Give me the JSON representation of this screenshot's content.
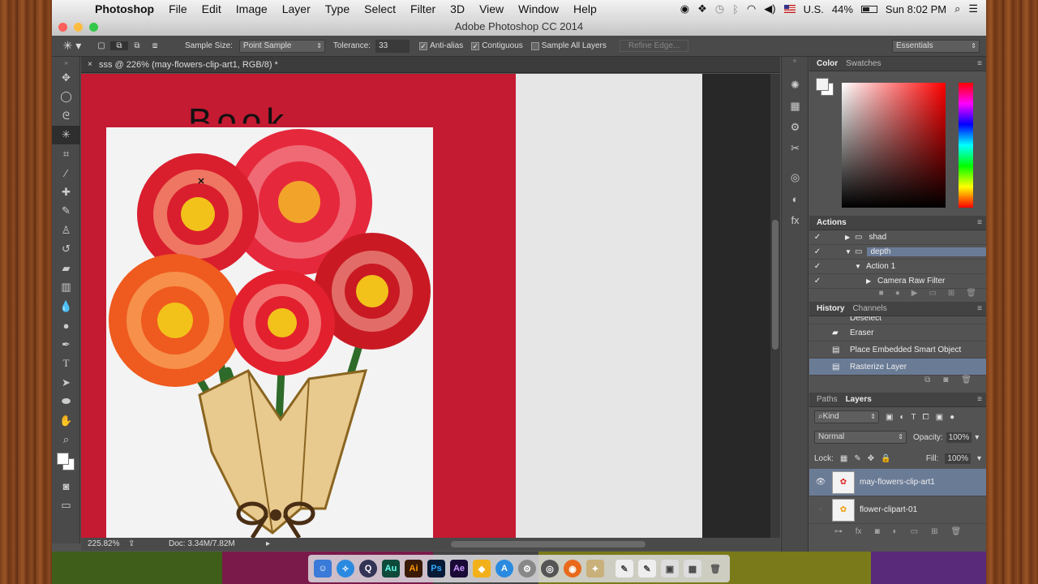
{
  "menubar": {
    "app": "Photoshop",
    "items": [
      "File",
      "Edit",
      "Image",
      "Layer",
      "Type",
      "Select",
      "Filter",
      "3D",
      "View",
      "Window",
      "Help"
    ],
    "input_source": "U.S.",
    "battery": "44%",
    "clock": "Sun 8:02 PM"
  },
  "window": {
    "title": "Adobe Photoshop CC 2014"
  },
  "options": {
    "sample_size_label": "Sample Size:",
    "sample_size_value": "Point Sample",
    "tolerance_label": "Tolerance:",
    "tolerance_value": "33",
    "antialias": "Anti-alias",
    "contiguous": "Contiguous",
    "sample_all": "Sample All Layers",
    "refine_edge": "Refine Edge...",
    "workspace": "Essentials"
  },
  "document": {
    "tab": "sss @ 226% (may-flowers-clip-art1, RGB/8) *",
    "canvas_text": "Book",
    "zoom": "225.82%",
    "doc_size": "Doc: 3.34M/7.82M"
  },
  "color_panel": {
    "tabs": [
      "Color",
      "Swatches"
    ]
  },
  "actions_panel": {
    "title": "Actions",
    "items": [
      "shad",
      "depth",
      "Action 1",
      "Camera Raw Filter"
    ]
  },
  "history_panel": {
    "tabs": [
      "History",
      "Channels"
    ],
    "items": [
      "Deselect",
      "Eraser",
      "Place Embedded Smart Object",
      "Rasterize Layer"
    ]
  },
  "layers_panel": {
    "tabs": [
      "Paths",
      "Layers"
    ],
    "filter": "Kind",
    "blend_mode": "Normal",
    "opacity_label": "Opacity:",
    "opacity": "100%",
    "lock_label": "Lock:",
    "fill_label": "Fill:",
    "fill": "100%",
    "layers": [
      "may-flowers-clip-art1",
      "flower-clipart-01"
    ]
  },
  "dock": {
    "apps": [
      "Au",
      "Ai",
      "Ps",
      "Ae"
    ]
  },
  "colors": {
    "canvas_red": "#c41a32",
    "selection": "#6a7b96"
  }
}
